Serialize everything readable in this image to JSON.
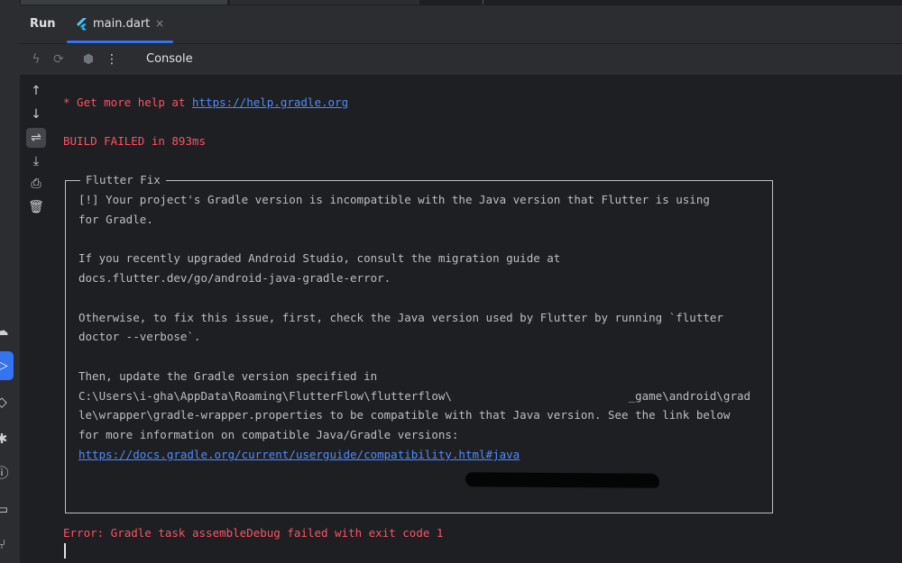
{
  "tabbar": {
    "run_label": "Run",
    "tab_label": "main.dart",
    "close_symbol": "×"
  },
  "toolbar": {
    "console_label": "Console"
  },
  "icons": {
    "left_strip": [
      "cloud-icon",
      "run-icon",
      "diamond-icon",
      "bug-icon",
      "warning-icon",
      "terminal-icon",
      "git-icon"
    ],
    "side_actions": [
      "arrow-up-icon",
      "arrow-down-icon",
      "soft-wrap-icon",
      "scroll-to-end-icon",
      "print-icon",
      "trash-icon"
    ],
    "toolbar": [
      "rerun-icon",
      "restart-icon",
      "stop-icon",
      "more-icon"
    ]
  },
  "console": {
    "help_prefix": "* Get more help at ",
    "help_link": "https://help.gradle.org",
    "build_failed": "BUILD FAILED in 893ms",
    "fix_title": "Flutter Fix",
    "fix_lines": [
      "[!] Your project's Gradle version is incompatible with the Java version that Flutter is using",
      "for Gradle.",
      "",
      "If you recently upgraded Android Studio, consult the migration guide at",
      "docs.flutter.dev/go/android-java-gradle-error.",
      "",
      "Otherwise, to fix this issue, first, check the Java version used by Flutter by running `flutter",
      "doctor --verbose`.",
      "",
      "Then, update the Gradle version specified in",
      "C:\\Users\\i-gha\\AppData\\Roaming\\FlutterFlow\\flutterflow\\                          _game\\android\\grad",
      "le\\wrapper\\gradle-wrapper.properties to be compatible with that Java version. See the link below",
      "for more information on compatible Java/Gradle versions:"
    ],
    "fix_link": "https://docs.gradle.org/current/userguide/compatibility.html#java",
    "error_line": "Error: Gradle task assembleDebug failed with exit code 1"
  },
  "colors": {
    "background": "#1e1f22",
    "panel": "#2b2d30",
    "accent": "#3574f0",
    "error_red": "#f75464",
    "link_blue": "#548af7",
    "text": "#bcbec4"
  }
}
